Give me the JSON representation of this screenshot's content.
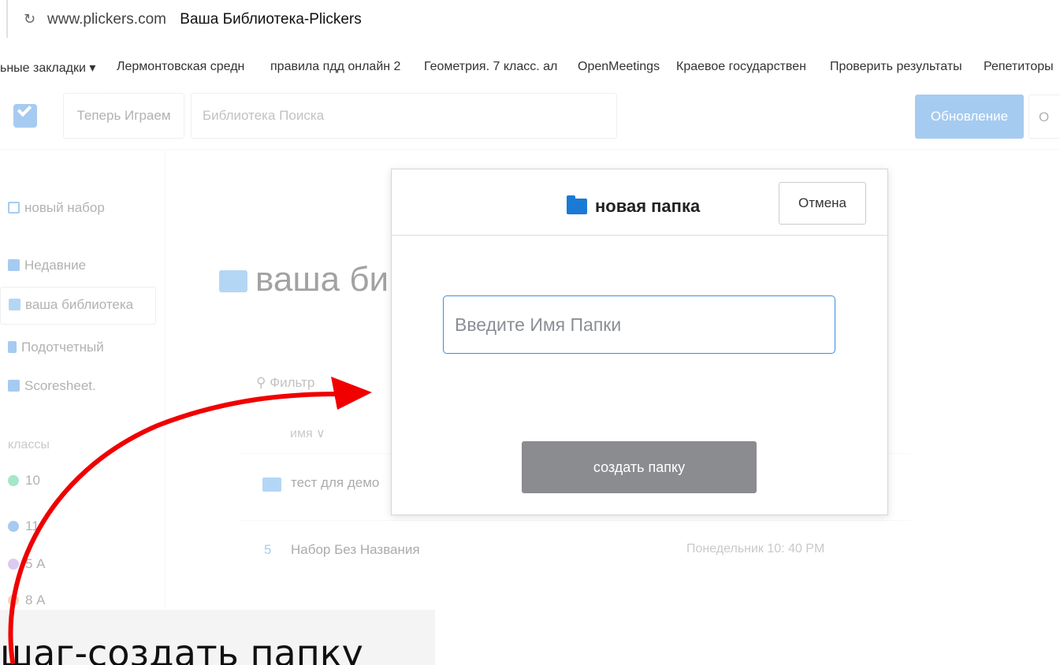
{
  "browser": {
    "domain": "www.plickers.com",
    "tab_title": "Ваша Библиотека-Plickers",
    "reload_glyph": "↻"
  },
  "bookmarks": [
    "ьные закладки ▾",
    "Лермонтовская средн",
    "правила пдд онлайн 2",
    "Геометрия. 7 класс. ал",
    "OpenMeetings",
    "Краевое государствен",
    "Проверить результаты",
    "Репетиторы"
  ],
  "header": {
    "now_playing": "Теперь Играем",
    "search_placeholder": "Библиотека Поиска",
    "update_label": "Обновление",
    "other_label": "О"
  },
  "sidebar": {
    "new_set": "новый набор",
    "recent": "Недавние",
    "library": "ваша библиотека",
    "reports": "Подотчетный",
    "scoresheet": "Scoresheet.",
    "classes_label": "классы",
    "classes": [
      {
        "name": "10",
        "color": "#3cc98a"
      },
      {
        "name": "11",
        "color": "#3b8ee0"
      },
      {
        "name": "5 А",
        "color": "#b88ae6"
      },
      {
        "name": "8 А",
        "color": "#f29a62"
      }
    ]
  },
  "main": {
    "title": "ваша би",
    "filter": "Фильтр",
    "col_name": "имя ∨",
    "rows": [
      {
        "name": "тест для демо",
        "time": ""
      },
      {
        "num": "5",
        "name": "Набор Без Названия",
        "time": "Понедельник 10: 40 PM"
      }
    ]
  },
  "modal": {
    "title": "новая папка",
    "cancel_label": "Отмена",
    "input_placeholder": "Введите Имя Папки",
    "create_label": "создать папку"
  },
  "caption": "шаг-создать папку",
  "colors": {
    "accent": "#3b8ee0",
    "folder": "#1a7ad6",
    "create_button": "#8a8c8f",
    "arrow": "#f00000"
  }
}
